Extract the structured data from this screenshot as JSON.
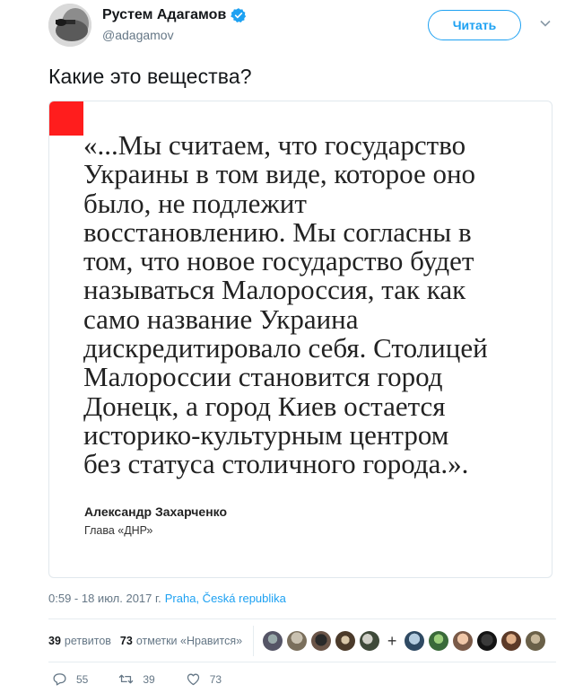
{
  "author": {
    "display_name": "Рустем Адагамов",
    "handle": "@adagamov",
    "verified": true
  },
  "follow_button": {
    "label": "Читать"
  },
  "tweet": {
    "text": "Какие это вещества?",
    "quote_card": {
      "quote_lines": [
        "«...Мы считаем, что государство",
        "Украины в том виде, которое оно",
        "было, не подлежит",
        "восстановлению. Мы согласны в",
        "том, что новое государство будет",
        "называться Малороссия, так как",
        "само название Украина",
        "дискредитировало себя. Столицей",
        "Малороссии становится город",
        "Донецк, а город Киев остается",
        "историко-культурным центром",
        "без статуса столичного города.»."
      ],
      "author_name": "Александр Захарченко",
      "author_role": "Глава «ДНР»",
      "accent_color": "#ff1d1d"
    },
    "timestamp": "0:59 - 18 июл. 2017 г.",
    "location": "Praha, Česká republika"
  },
  "stats": {
    "retweets_count": "39",
    "retweets_label": "ретвитов",
    "likes_count": "73",
    "likes_label": "отметки «Нравится»"
  },
  "actions": {
    "replies": "55",
    "retweets": "39",
    "likes": "73"
  },
  "colors": {
    "accent": "#1da1f2",
    "muted": "#657786"
  }
}
